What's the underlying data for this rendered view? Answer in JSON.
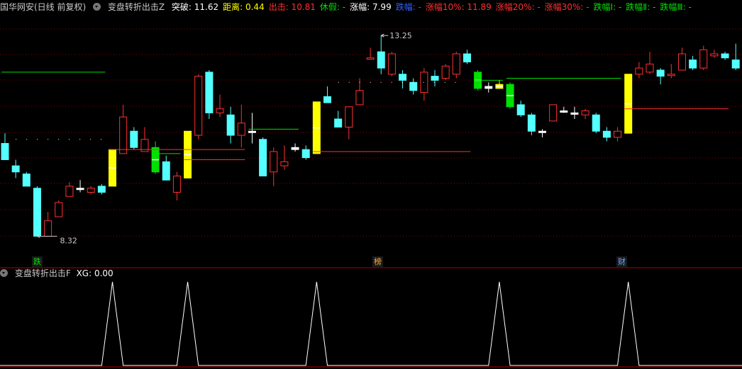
{
  "header": {
    "title": "国华网安(日线 前复权)",
    "indicator_name": "变盘转折出击Z",
    "items": [
      {
        "label": "突破: 11.62",
        "color": "#ffffff"
      },
      {
        "label": "距离: 0.44",
        "color": "#ffff00"
      },
      {
        "label": "出击: 10.81",
        "color": "#ff3030"
      },
      {
        "label": "休假: -",
        "color": "#00e000"
      },
      {
        "label": "涨幅: 7.99",
        "color": "#ffffff"
      },
      {
        "label": "跌幅: -",
        "color": "#3060ff"
      },
      {
        "label": "涨幅10%: 11.89",
        "color": "#ff3030"
      },
      {
        "label": "涨幅20%: -",
        "color": "#ff3030"
      },
      {
        "label": "涨幅30%: -",
        "color": "#ff3030"
      },
      {
        "label": "跌幅Ⅰ: -",
        "color": "#00e000"
      },
      {
        "label": "跌幅Ⅱ: -",
        "color": "#00e000"
      },
      {
        "label": "跌幅Ⅲ: -",
        "color": "#00e000"
      }
    ]
  },
  "sub_header": {
    "indicator_name": "变盘转折出击F",
    "value_label": "XG: 0.00"
  },
  "annotations": {
    "high_label": "13.25",
    "low_label": "8.32"
  },
  "tags": [
    {
      "text": "跌",
      "color": "#00e000"
    },
    {
      "text": "榜",
      "color": "#ffaa33"
    },
    {
      "text": "财",
      "color": "#66aaff"
    }
  ],
  "colors": {
    "up": "#ff3030",
    "down": "#54ffff",
    "signal_yellow": "#ffff00",
    "signal_green": "#00e000",
    "grid": "#8b0000",
    "indicator_line": "#ffffff"
  },
  "chart_data": {
    "type": "candlestick",
    "price_range": [
      8.0,
      13.6
    ],
    "candles": [
      {
        "o": 10.6,
        "h": 10.85,
        "c": 10.2,
        "l": 10.2,
        "k": "down"
      },
      {
        "o": 10.05,
        "h": 10.2,
        "c": 9.9,
        "l": 9.75,
        "k": "down"
      },
      {
        "o": 9.85,
        "h": 9.9,
        "c": 9.55,
        "l": 9.55,
        "k": "down"
      },
      {
        "o": 9.5,
        "h": 9.55,
        "c": 8.32,
        "l": 8.32,
        "k": "down"
      },
      {
        "o": 8.32,
        "h": 8.92,
        "c": 8.7,
        "l": 8.32,
        "k": "up"
      },
      {
        "o": 8.8,
        "h": 9.2,
        "c": 9.15,
        "l": 8.8,
        "k": "up"
      },
      {
        "o": 9.3,
        "h": 9.65,
        "c": 9.55,
        "l": 9.3,
        "k": "up"
      },
      {
        "o": 9.5,
        "h": 9.7,
        "c": 9.5,
        "l": 9.4,
        "k": "flat"
      },
      {
        "o": 9.4,
        "h": 9.55,
        "c": 9.5,
        "l": 9.35,
        "k": "up"
      },
      {
        "o": 9.55,
        "h": 9.6,
        "c": 9.4,
        "l": 9.35,
        "k": "down"
      },
      {
        "o": 9.55,
        "h": 10.45,
        "c": 10.45,
        "l": 9.55,
        "k": "yellow"
      },
      {
        "o": 10.35,
        "h": 11.55,
        "c": 11.25,
        "l": 10.35,
        "k": "up"
      },
      {
        "o": 10.9,
        "h": 11.0,
        "c": 10.5,
        "l": 10.45,
        "k": "down"
      },
      {
        "o": 10.7,
        "h": 11.0,
        "c": 10.4,
        "l": 10.4,
        "k": "up"
      },
      {
        "o": 10.5,
        "h": 10.65,
        "c": 9.9,
        "l": 9.85,
        "k": "green"
      },
      {
        "o": 10.15,
        "h": 10.3,
        "c": 9.7,
        "l": 9.7,
        "k": "down"
      },
      {
        "o": 9.4,
        "h": 9.9,
        "c": 9.8,
        "l": 9.2,
        "k": "up"
      },
      {
        "o": 9.75,
        "h": 10.9,
        "c": 10.9,
        "l": 9.75,
        "k": "yellow"
      },
      {
        "o": 10.8,
        "h": 12.3,
        "c": 12.25,
        "l": 10.7,
        "k": "up"
      },
      {
        "o": 12.35,
        "h": 12.4,
        "c": 11.35,
        "l": 11.2,
        "k": "down"
      },
      {
        "o": 11.35,
        "h": 11.8,
        "c": 11.45,
        "l": 11.25,
        "k": "up"
      },
      {
        "o": 11.3,
        "h": 11.5,
        "c": 10.8,
        "l": 10.6,
        "k": "down"
      },
      {
        "o": 10.8,
        "h": 11.55,
        "c": 11.1,
        "l": 10.5,
        "k": "up"
      },
      {
        "o": 10.9,
        "h": 11.35,
        "c": 10.9,
        "l": 10.6,
        "k": "flat"
      },
      {
        "o": 10.7,
        "h": 10.75,
        "c": 9.8,
        "l": 9.8,
        "k": "down"
      },
      {
        "o": 9.9,
        "h": 10.5,
        "c": 10.4,
        "l": 9.55,
        "k": "up"
      },
      {
        "o": 10.05,
        "h": 10.55,
        "c": 10.15,
        "l": 9.95,
        "k": "up"
      },
      {
        "o": 10.45,
        "h": 10.6,
        "c": 10.5,
        "l": 10.4,
        "k": "flat"
      },
      {
        "o": 10.45,
        "h": 10.55,
        "c": 10.25,
        "l": 10.2,
        "k": "down"
      },
      {
        "o": 10.35,
        "h": 11.62,
        "c": 11.62,
        "l": 10.35,
        "k": "yellow"
      },
      {
        "o": 11.6,
        "h": 12.0,
        "c": 11.75,
        "l": 11.6,
        "k": "down"
      },
      {
        "o": 11.2,
        "h": 11.4,
        "c": 11.0,
        "l": 11.0,
        "k": "down"
      },
      {
        "o": 11.0,
        "h": 11.5,
        "c": 11.5,
        "l": 10.7,
        "k": "up"
      },
      {
        "o": 11.55,
        "h": 12.2,
        "c": 11.9,
        "l": 11.55,
        "k": "up"
      },
      {
        "o": 12.7,
        "h": 12.95,
        "c": 12.7,
        "l": 12.7,
        "k": "up"
      },
      {
        "o": 12.85,
        "h": 13.25,
        "c": 12.45,
        "l": 12.3,
        "k": "down"
      },
      {
        "o": 12.3,
        "h": 12.85,
        "c": 12.8,
        "l": 12.25,
        "k": "up"
      },
      {
        "o": 12.3,
        "h": 12.4,
        "c": 12.15,
        "l": 11.95,
        "k": "down"
      },
      {
        "o": 12.1,
        "h": 12.2,
        "c": 11.9,
        "l": 11.8,
        "k": "down"
      },
      {
        "o": 11.85,
        "h": 12.45,
        "c": 12.35,
        "l": 11.65,
        "k": "up"
      },
      {
        "o": 12.25,
        "h": 12.4,
        "c": 12.15,
        "l": 12.0,
        "k": "down"
      },
      {
        "o": 12.2,
        "h": 12.55,
        "c": 12.5,
        "l": 12.15,
        "k": "up"
      },
      {
        "o": 12.8,
        "h": 12.85,
        "c": 12.3,
        "l": 12.2,
        "k": "up"
      },
      {
        "o": 12.8,
        "h": 12.9,
        "c": 12.6,
        "l": 12.55,
        "k": "down"
      },
      {
        "o": 12.35,
        "h": 12.4,
        "c": 11.95,
        "l": 11.9,
        "k": "green"
      },
      {
        "o": 12.0,
        "h": 12.1,
        "c": 11.95,
        "l": 11.85,
        "k": "flat"
      },
      {
        "o": 12.05,
        "h": 12.15,
        "c": 11.95,
        "l": 11.95,
        "k": "yellow"
      },
      {
        "o": 12.05,
        "h": 12.1,
        "c": 11.5,
        "l": 11.45,
        "k": "green"
      },
      {
        "o": 11.55,
        "h": 11.65,
        "c": 11.3,
        "l": 11.25,
        "k": "down"
      },
      {
        "o": 11.3,
        "h": 11.35,
        "c": 10.9,
        "l": 10.8,
        "k": "down"
      },
      {
        "o": 10.9,
        "h": 10.95,
        "c": 10.9,
        "l": 10.75,
        "k": "flat"
      },
      {
        "o": 11.15,
        "h": 11.55,
        "c": 11.55,
        "l": 11.15,
        "k": "up"
      },
      {
        "o": 11.4,
        "h": 11.5,
        "c": 11.4,
        "l": 11.35,
        "k": "flat"
      },
      {
        "o": 11.35,
        "h": 11.5,
        "c": 11.35,
        "l": 11.2,
        "k": "flat"
      },
      {
        "o": 11.3,
        "h": 11.45,
        "c": 11.4,
        "l": 11.2,
        "k": "up"
      },
      {
        "o": 11.3,
        "h": 11.35,
        "c": 10.9,
        "l": 10.85,
        "k": "down"
      },
      {
        "o": 10.9,
        "h": 11.0,
        "c": 10.75,
        "l": 10.65,
        "k": "down"
      },
      {
        "o": 10.75,
        "h": 11.0,
        "c": 10.9,
        "l": 10.65,
        "k": "up"
      },
      {
        "o": 10.85,
        "h": 12.3,
        "c": 12.3,
        "l": 10.85,
        "k": "yellow"
      },
      {
        "o": 12.3,
        "h": 12.6,
        "c": 12.45,
        "l": 12.2,
        "k": "up"
      },
      {
        "o": 12.35,
        "h": 12.85,
        "c": 12.55,
        "l": 12.3,
        "k": "up"
      },
      {
        "o": 12.4,
        "h": 12.45,
        "c": 12.25,
        "l": 12.05,
        "k": "down"
      },
      {
        "o": 12.3,
        "h": 12.55,
        "c": 12.3,
        "l": 12.2,
        "k": "up"
      },
      {
        "o": 12.4,
        "h": 12.95,
        "c": 12.8,
        "l": 12.4,
        "k": "up"
      },
      {
        "o": 12.65,
        "h": 12.75,
        "c": 12.45,
        "l": 12.4,
        "k": "down"
      },
      {
        "o": 12.45,
        "h": 13.0,
        "c": 12.9,
        "l": 12.4,
        "k": "up"
      },
      {
        "o": 12.8,
        "h": 12.9,
        "c": 12.75,
        "l": 12.7,
        "k": "up"
      },
      {
        "o": 12.8,
        "h": 12.85,
        "c": 12.7,
        "l": 12.65,
        "k": "down"
      },
      {
        "o": 12.65,
        "h": 13.05,
        "c": 12.45,
        "l": 12.4,
        "k": "down"
      }
    ],
    "signal_spikes_at_candle": [
      10,
      17,
      29,
      46,
      58
    ]
  }
}
